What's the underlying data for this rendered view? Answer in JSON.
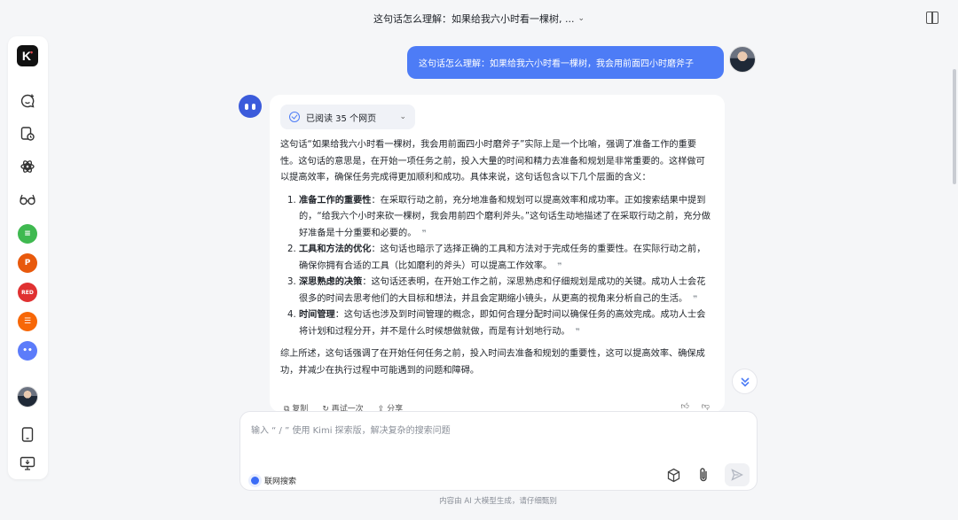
{
  "header": {
    "title": "这句话怎么理解：如果给我六小时看一棵树, ...",
    "chevron": "⌄"
  },
  "sidebar": {
    "logo_text": "K",
    "items": [
      {
        "name": "new-chat-icon"
      },
      {
        "name": "history-icon"
      },
      {
        "name": "explore-icon"
      },
      {
        "name": "glasses-icon"
      },
      {
        "name": "app-green",
        "color": "#3fb950"
      },
      {
        "name": "app-ppt",
        "label": "P",
        "color": "#e8590c"
      },
      {
        "name": "app-red",
        "label": "RED",
        "color": "#e03131"
      },
      {
        "name": "app-orange",
        "color": "#f76707"
      },
      {
        "name": "app-blue",
        "color": "#5c7cfa"
      }
    ]
  },
  "user_message": "这句话怎么理解：如果给我六小时看一棵树，我会用前面四小时磨斧子",
  "answer": {
    "read_label": "已阅读 35 个网页",
    "intro": "这句话“如果给我六小时看一棵树，我会用前面四小时磨斧子”实际上是一个比喻，强调了准备工作的重要性。这句话的意思是，在开始一项任务之前，投入大量的时间和精力去准备和规划是非常重要的。这样做可以提高效率，确保任务完成得更加顺利和成功。具体来说，这句话包含以下几个层面的含义：",
    "points": [
      {
        "title": "准备工作的重要性",
        "text": "：在采取行动之前，充分地准备和规划可以提高效率和成功率。正如搜索结果中提到的，“给我六个小时来砍一棵树，我会用前四个磨利斧头。”这句话生动地描述了在采取行动之前，充分做好准备是十分重要和必要的。"
      },
      {
        "title": "工具和方法的优化",
        "text": "：这句话也暗示了选择正确的工具和方法对于完成任务的重要性。在实际行动之前，确保你拥有合适的工具（比如磨利的斧头）可以提高工作效率。"
      },
      {
        "title": "深思熟虑的决策",
        "text": "：这句话还表明，在开始工作之前，深思熟虑和仔细规划是成功的关键。成功人士会花很多的时间去思考他们的大目标和想法，并且会定期缩小镜头，从更高的视角来分析自己的生活。"
      },
      {
        "title": "时间管理",
        "text": "：这句话也涉及到时间管理的概念，即如何合理分配时间以确保任务的高效完成。成功人士会将计划和过程分开，并不是什么时候想做就做，而是有计划地行动。"
      }
    ],
    "cite_mark": "❞",
    "summary": "综上所述，这句话强调了在开始任何任务之前，投入时间去准备和规划的重要性，这可以提高效率、确保成功，并减少在执行过程中可能遇到的问题和障碍。",
    "actions": {
      "copy": "复制",
      "retry": "再试一次",
      "share": "分享"
    }
  },
  "input": {
    "placeholder": "输入 “ / ” 使用 Kimi 探索版，解决复杂的搜索问题",
    "web_search_label": "联网搜索"
  },
  "footer_note": "内容由 AI 大模型生成，请仔细甄别"
}
